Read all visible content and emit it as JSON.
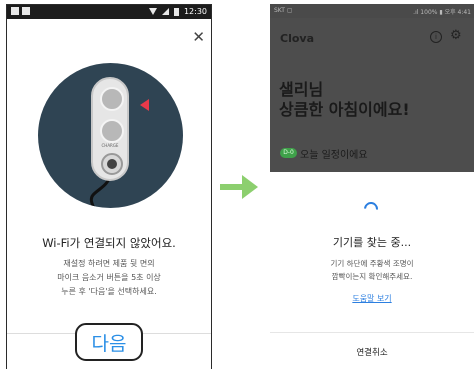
{
  "left_screen": {
    "status_time": "12:30",
    "device_charge_label": "CHARGE",
    "wifi_message": "Wi-Fi가 연결되지 않았어요.",
    "instructions": [
      "재설정 하려면 제품 뒷 면의",
      "마이크 음소거 버튼을 5초 이상",
      "누른 후 '다음'을 선택하세요."
    ],
    "next_button": "다음"
  },
  "right_screen": {
    "status_left": "SKT ▢",
    "status_right": ".ıl 100% ▮ 오후 4:41",
    "app_title": "Clova",
    "greeting_line1": "샐리님",
    "greeting_line2": "상큼한 아침이에요!",
    "schedule_badge": "D-0",
    "schedule_text": "오늘 일정이에요",
    "searching_title": "기기를 찾는 중...",
    "search_desc": [
      "기기 하단에 주황색 조명이",
      "깜빡이는지 확인해주세요."
    ],
    "help_link": "도움말 보기",
    "cancel_button": "연결취소"
  },
  "colors": {
    "accent_blue": "#2b8fe6",
    "arrow_green": "#8ccf6e",
    "alert_red": "#e8394a",
    "device_bg": "#2f4453"
  }
}
